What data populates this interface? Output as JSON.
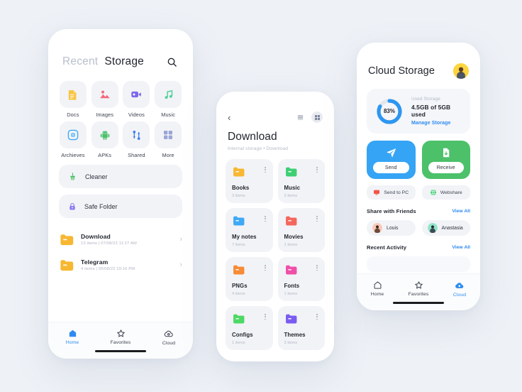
{
  "background_color": "#eef1f6",
  "accent_color": "#2d8bf0",
  "phone1": {
    "name": "recent-storage-screen",
    "tabs": [
      {
        "label": "Recent",
        "active": false
      },
      {
        "label": "Storage",
        "active": true
      }
    ],
    "search_icon": "search-icon",
    "categories": [
      {
        "label": "Docs",
        "icon": "document-icon",
        "color": "#f7c544"
      },
      {
        "label": "Images",
        "icon": "image-icon",
        "color": "#f4677a"
      },
      {
        "label": "Videos",
        "icon": "video-icon",
        "color": "#7b68ee"
      },
      {
        "label": "Music",
        "icon": "music-note-icon",
        "color": "#4dd09a"
      },
      {
        "label": "Archieves",
        "icon": "archive-icon",
        "color": "#3fa9f5"
      },
      {
        "label": "APKs",
        "icon": "android-icon",
        "color": "#4cc16a"
      },
      {
        "label": "Shared",
        "icon": "shared-icon",
        "color": "#3d7ef0"
      },
      {
        "label": "More",
        "icon": "grid-more-icon",
        "color": "#9aa6d6"
      }
    ],
    "quick_rows": [
      {
        "label": "Cleaner",
        "icon": "broom-icon",
        "color": "#4cc16a"
      },
      {
        "label": "Safe Folder",
        "icon": "lock-icon",
        "color": "#8b7cf0"
      }
    ],
    "folders": [
      {
        "name": "Download",
        "meta": "13 items  |  07/08/22 11:27 AM",
        "color": "#f7b731"
      },
      {
        "name": "Telegram",
        "meta": "4 items  |  05/08/22 19:16 PM",
        "color": "#f7b731"
      }
    ],
    "nav": [
      {
        "label": "Home",
        "icon": "home-icon",
        "active": true
      },
      {
        "label": "Favorites",
        "icon": "star-icon",
        "active": false
      },
      {
        "label": "Cloud",
        "icon": "cloud-icon",
        "active": false
      }
    ]
  },
  "phone2": {
    "name": "download-folder-screen",
    "back_icon": "chevron-left-icon",
    "view_toggles": [
      {
        "icon": "list-view-icon",
        "active": false
      },
      {
        "icon": "grid-view-icon",
        "active": true
      }
    ],
    "title": "Download",
    "breadcrumb": "Internal storage  •  Download",
    "files": [
      {
        "name": "Books",
        "meta": "3 items",
        "color": "#f7b731",
        "menu_icon": "kebab-menu-icon"
      },
      {
        "name": "Music",
        "meta": "2 items",
        "color": "#3ecf73",
        "menu_icon": "kebab-menu-icon"
      },
      {
        "name": "My notes",
        "meta": "7 items",
        "color": "#3fa9f5",
        "menu_icon": "kebab-menu-icon"
      },
      {
        "name": "Movies",
        "meta": "1 items",
        "color": "#f4675d",
        "menu_icon": "kebab-menu-icon"
      },
      {
        "name": "PNGs",
        "meta": "4 items",
        "color": "#f78b36",
        "menu_icon": "kebab-menu-icon"
      },
      {
        "name": "Fonts",
        "meta": "1 items",
        "color": "#ef4fa8",
        "menu_icon": "kebab-menu-icon"
      },
      {
        "name": "Configs",
        "meta": "1 items",
        "color": "#4cd964",
        "menu_icon": "kebab-menu-icon"
      },
      {
        "name": "Themes",
        "meta": "3 items",
        "color": "#7b5cf0",
        "menu_icon": "kebab-menu-icon"
      }
    ]
  },
  "phone3": {
    "name": "cloud-storage-screen",
    "title": "Cloud Storage",
    "avatar": "user-avatar",
    "storage": {
      "percent_label": "83%",
      "percent_value": 83,
      "caption": "Used Storage",
      "value": "4.5GB of 5GB used",
      "link": "Manage Storage",
      "ring_color": "#2d96f0",
      "track_color": "#e2e6ee"
    },
    "actions": [
      {
        "label": "Send",
        "icon": "paper-plane-icon",
        "color": "#35a4f5"
      },
      {
        "label": "Receive",
        "icon": "file-download-icon",
        "color": "#4cc16a"
      }
    ],
    "sub_actions": [
      {
        "label": "Send to PC",
        "icon": "monitor-icon",
        "color": "#f4544a"
      },
      {
        "label": "Webshare",
        "icon": "globe-icon",
        "color": "#3ecf73"
      }
    ],
    "friends_section": {
      "title": "Share with Friends",
      "link": "View All",
      "friends": [
        {
          "name": "Louis",
          "avatar_color": "#f8c9b8"
        },
        {
          "name": "Anastasia",
          "avatar_color": "#8fe7c8"
        }
      ]
    },
    "activity_section": {
      "title": "Recent Activity",
      "link": "View All"
    },
    "nav": [
      {
        "label": "Home",
        "icon": "home-icon",
        "active": false
      },
      {
        "label": "Favorites",
        "icon": "star-icon",
        "active": false
      },
      {
        "label": "Cloud",
        "icon": "cloud-icon",
        "active": true
      }
    ]
  }
}
